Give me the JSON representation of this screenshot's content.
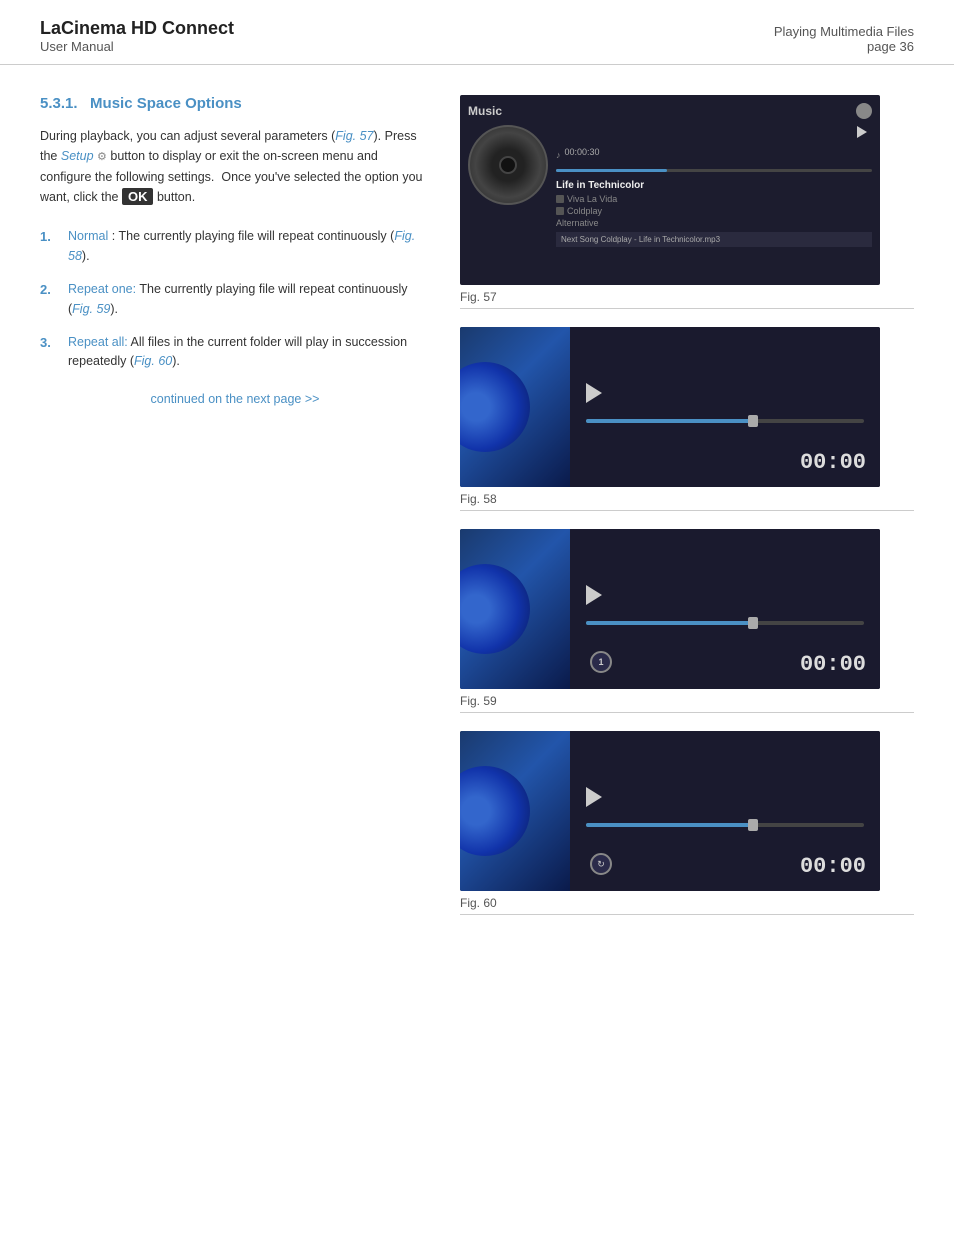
{
  "header": {
    "title": "LaCinema HD Connect",
    "subtitle": "User Manual",
    "section": "Playing Multimedia Files",
    "page": "page 36"
  },
  "section": {
    "number": "5.3.1.",
    "title": "Music Space Options",
    "intro": {
      "part1": "During playback, you can adjust several parameters (",
      "fig_link1": "Fig. 57",
      "part2": "). Press the ",
      "setup_label": "Setup",
      "part3": " button to display or exit the on-screen menu and configure the following settings.  Once you've selected the option you want, click the ",
      "ok_label": "OK",
      "part4": " button."
    },
    "options": [
      {
        "num": "1.",
        "name": "Normal",
        "separator": " : ",
        "text": "The currently playing file will repeat continuously (",
        "fig_link": "Fig. 58",
        "text2": ")."
      },
      {
        "num": "2.",
        "name": "Repeat one:",
        "text": " The currently playing file will repeat continuously (",
        "fig_link": "Fig. 59",
        "text2": ")."
      },
      {
        "num": "3.",
        "name": "Repeat all:",
        "text": " All files in the current folder will play in succession repeatedly (",
        "fig_link": "Fig. 60",
        "text2": ")."
      }
    ],
    "continued": "continued on the next page >>"
  },
  "figures": [
    {
      "id": "fig57",
      "label": "Fig. 57",
      "music_label": "Music",
      "song_title": "Life in Technicolor",
      "artist": "Viva La Vida",
      "album": "Coldplay",
      "genre": "Alternative",
      "next_song_label": "Next Song",
      "next_song": "Coldplay - Life in Technicolor.mp3",
      "time": "00:00:30"
    },
    {
      "id": "fig58",
      "label": "Fig. 58",
      "time": "00:00",
      "mode": "normal"
    },
    {
      "id": "fig59",
      "label": "Fig. 59",
      "time": "00:00",
      "mode": "repeat-one"
    },
    {
      "id": "fig60",
      "label": "Fig. 60",
      "time": "00:00",
      "mode": "repeat-all"
    }
  ]
}
